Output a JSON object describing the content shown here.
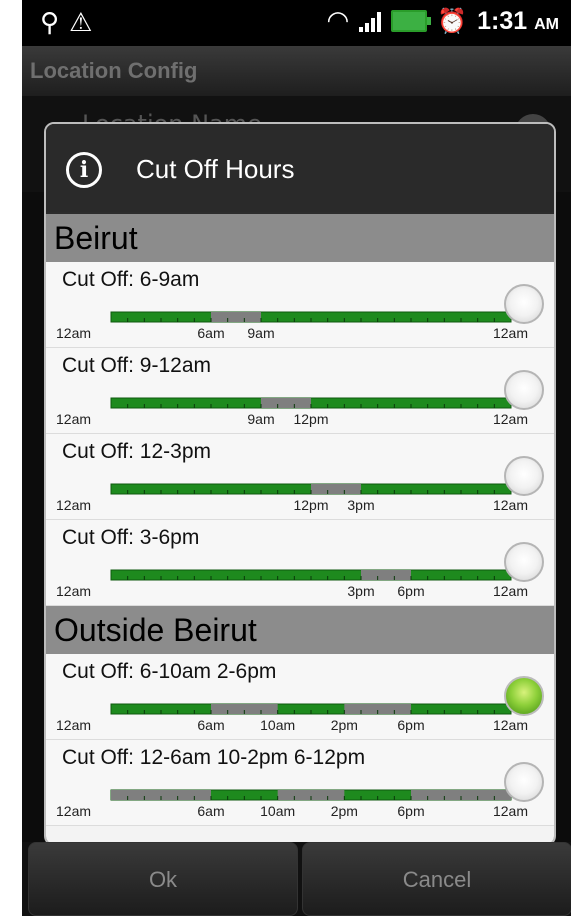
{
  "status_bar": {
    "time": "1:31",
    "ampm": "AM"
  },
  "app_bar": {
    "title": "Location Config"
  },
  "background_row": {
    "label": "Location Name"
  },
  "dialog": {
    "title": "Cut Off Hours",
    "sections": [
      {
        "name": "Beirut",
        "options": [
          {
            "label": "Cut Off:  6-9am",
            "cutoff_ranges": [
              [
                6,
                9
              ]
            ],
            "ticks": [
              [
                0,
                "12am"
              ],
              [
                6,
                "6am"
              ],
              [
                9,
                "9am"
              ],
              [
                24,
                "12am"
              ]
            ],
            "selected": false
          },
          {
            "label": "Cut Off:  9-12am",
            "cutoff_ranges": [
              [
                9,
                12
              ]
            ],
            "ticks": [
              [
                0,
                "12am"
              ],
              [
                9,
                "9am"
              ],
              [
                12,
                "12pm"
              ],
              [
                24,
                "12am"
              ]
            ],
            "selected": false
          },
          {
            "label": "Cut Off:  12-3pm",
            "cutoff_ranges": [
              [
                12,
                15
              ]
            ],
            "ticks": [
              [
                0,
                "12am"
              ],
              [
                12,
                "12pm"
              ],
              [
                15,
                "3pm"
              ],
              [
                24,
                "12am"
              ]
            ],
            "selected": false
          },
          {
            "label": "Cut Off:  3-6pm",
            "cutoff_ranges": [
              [
                15,
                18
              ]
            ],
            "ticks": [
              [
                0,
                "12am"
              ],
              [
                15,
                "3pm"
              ],
              [
                18,
                "6pm"
              ],
              [
                24,
                "12am"
              ]
            ],
            "selected": false
          }
        ]
      },
      {
        "name": "Outside Beirut",
        "options": [
          {
            "label": "Cut Off:  6-10am 2-6pm",
            "cutoff_ranges": [
              [
                6,
                10
              ],
              [
                14,
                18
              ]
            ],
            "ticks": [
              [
                0,
                "12am"
              ],
              [
                6,
                "6am"
              ],
              [
                10,
                "10am"
              ],
              [
                14,
                "2pm"
              ],
              [
                18,
                "6pm"
              ],
              [
                24,
                "12am"
              ]
            ],
            "selected": true
          },
          {
            "label": "Cut Off:  12-6am 10-2pm 6-12pm",
            "cutoff_ranges": [
              [
                0,
                6
              ],
              [
                10,
                14
              ],
              [
                18,
                24
              ]
            ],
            "ticks": [
              [
                0,
                "12am"
              ],
              [
                6,
                "6am"
              ],
              [
                10,
                "10am"
              ],
              [
                14,
                "2pm"
              ],
              [
                18,
                "6pm"
              ],
              [
                24,
                "12am"
              ]
            ],
            "selected": false
          }
        ]
      }
    ]
  },
  "buttons": {
    "ok": "Ok",
    "cancel": "Cancel"
  },
  "colors": {
    "open": "#1e8a1e",
    "cutoff": "#7f7f7f",
    "section_bg": "#8c8c8c",
    "radio_checked": "#8ed03a"
  }
}
